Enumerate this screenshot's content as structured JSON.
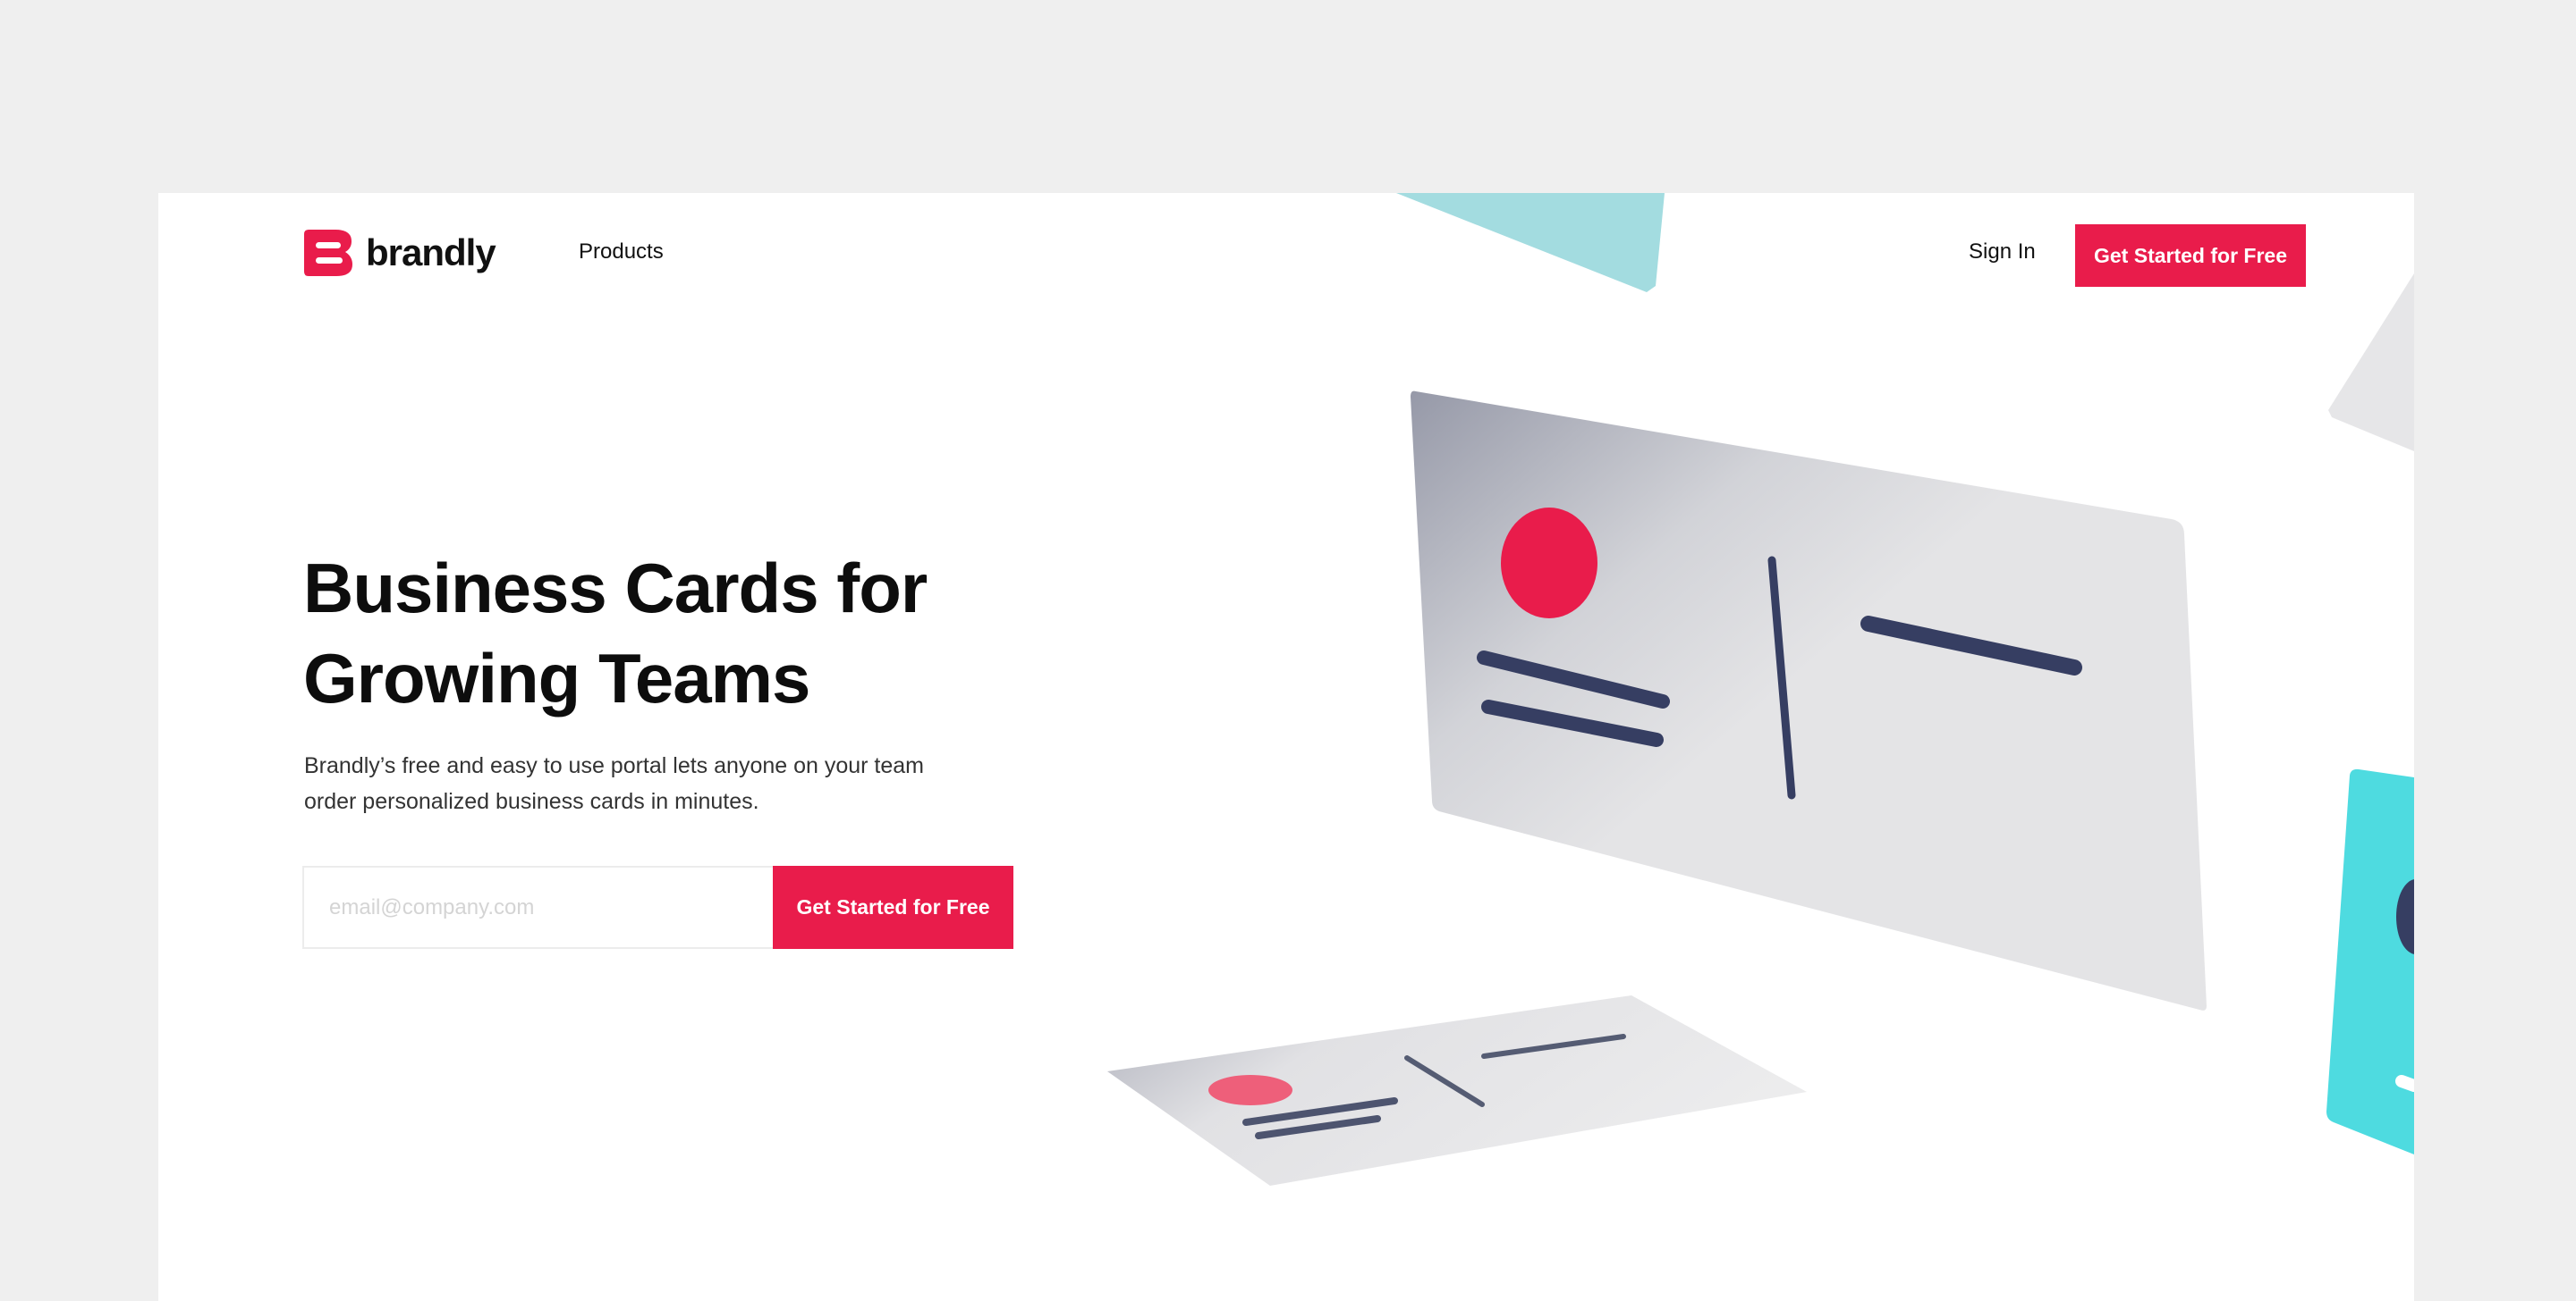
{
  "brand": {
    "name": "brandly",
    "accent_color": "#e91c4b"
  },
  "nav": {
    "products_label": "Products",
    "sign_in_label": "Sign In",
    "cta_label": "Get Started for Free"
  },
  "hero": {
    "title_line1": "Business Cards for",
    "title_line2": "Growing Teams",
    "subtitle_line1": "Brandly’s free and easy to use portal lets anyone on your team",
    "subtitle_line2": "order personalized business cards in minutes.",
    "email_placeholder": "email@company.com",
    "email_value": "",
    "cta_label": "Get Started for Free"
  },
  "illustration": {
    "card_accent_color": "#e91c4b",
    "card_line_color": "#363e62",
    "teal_card_color": "#4edbe0",
    "light_teal_color": "#a3dce0"
  }
}
